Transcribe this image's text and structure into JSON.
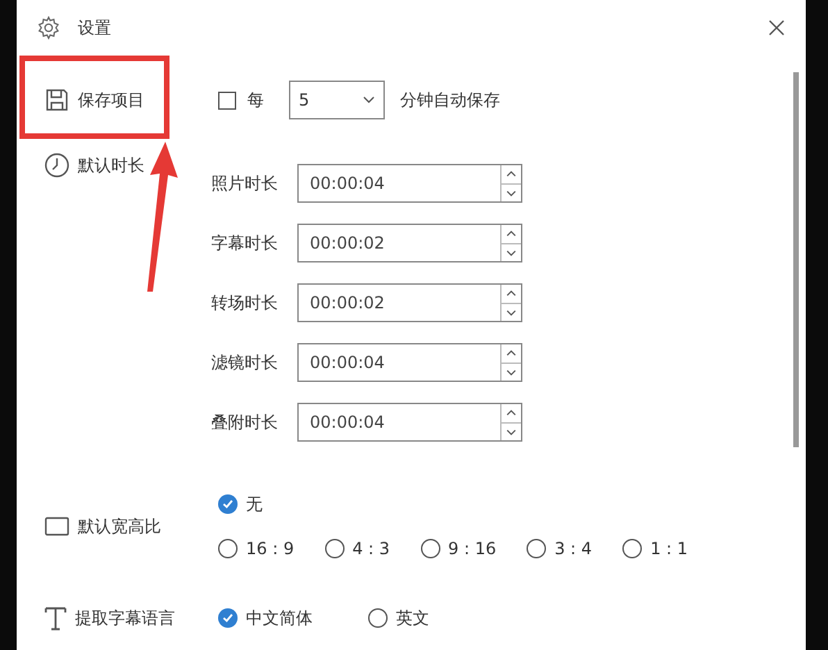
{
  "window": {
    "title": "设置"
  },
  "save_project": {
    "label": "保存项目",
    "auto_save": {
      "checked": false,
      "prefix": "每",
      "interval": "5",
      "suffix": "分钟自动保存"
    }
  },
  "default_duration": {
    "label": "默认时长",
    "fields": [
      {
        "label": "照片时长",
        "value": "00:00:04"
      },
      {
        "label": "字幕时长",
        "value": "00:00:02"
      },
      {
        "label": "转场时长",
        "value": "00:00:02"
      },
      {
        "label": "滤镜时长",
        "value": "00:00:04"
      },
      {
        "label": "叠附时长",
        "value": "00:00:04"
      }
    ]
  },
  "aspect_ratio": {
    "label": "默认宽高比",
    "options": [
      {
        "label": "无",
        "selected": true
      },
      {
        "label": "16 : 9",
        "selected": false
      },
      {
        "label": "4 : 3",
        "selected": false
      },
      {
        "label": "9 : 16",
        "selected": false
      },
      {
        "label": "3 : 4",
        "selected": false
      },
      {
        "label": "1 : 1",
        "selected": false
      }
    ]
  },
  "subtitle_language": {
    "label": "提取字幕语言",
    "options": [
      {
        "label": "中文简体",
        "selected": true
      },
      {
        "label": "英文",
        "selected": false
      }
    ]
  }
}
